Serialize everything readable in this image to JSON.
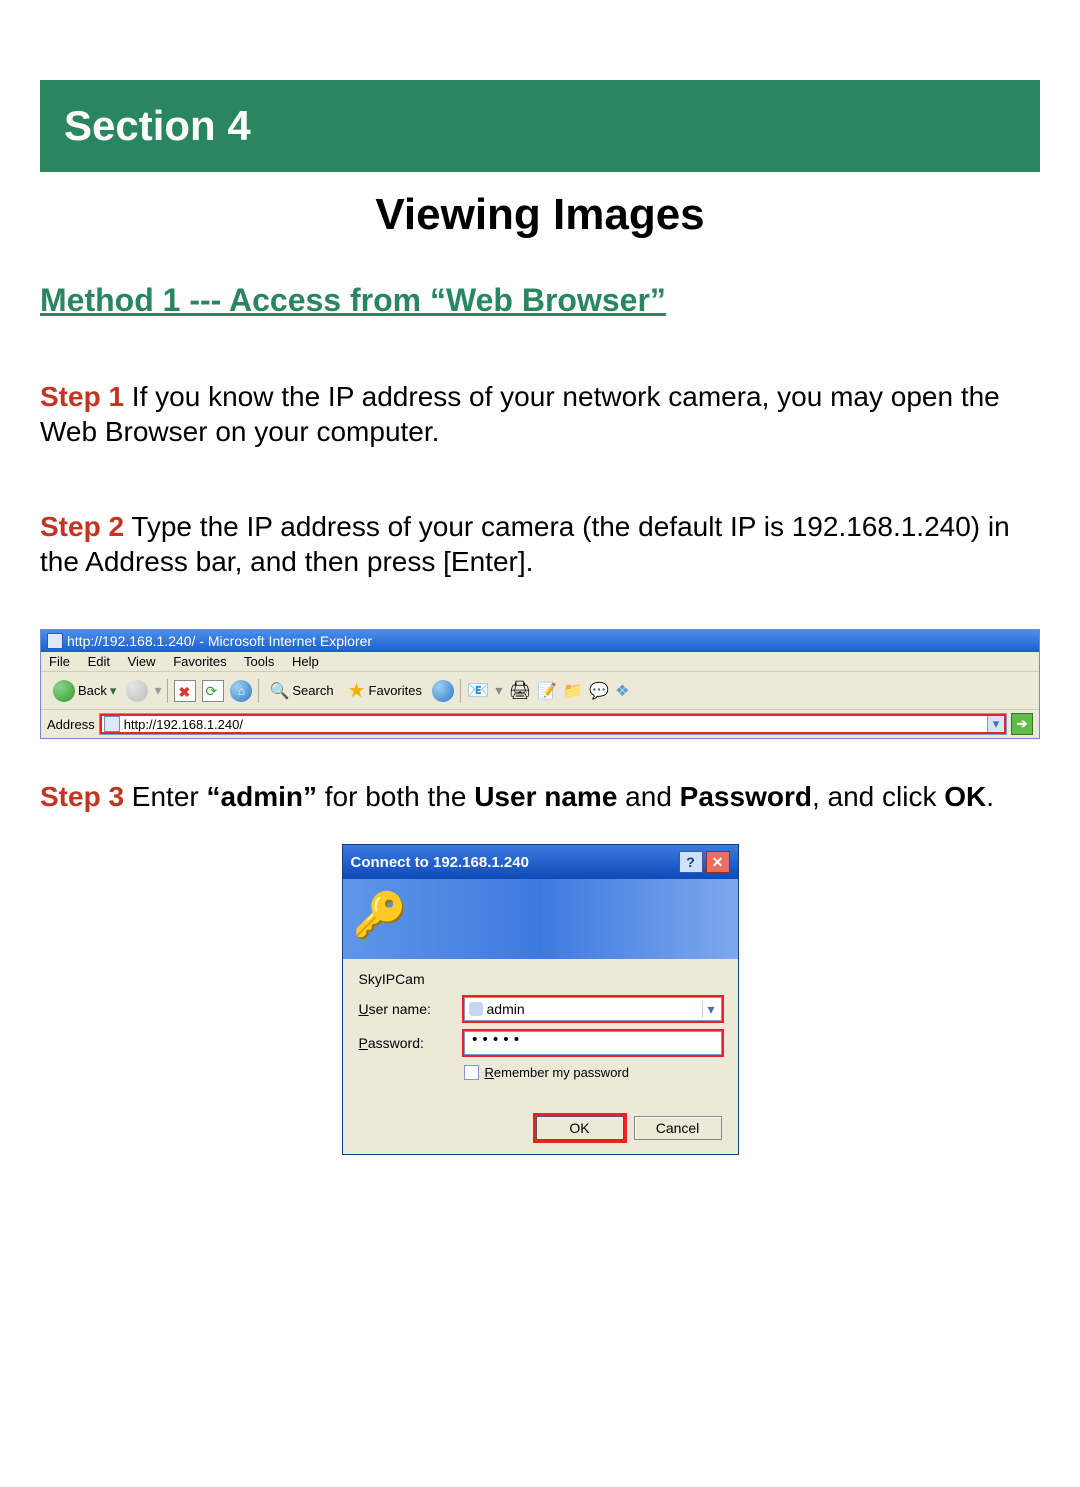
{
  "section_banner": "Section 4",
  "page_title": "Viewing Images",
  "method_heading": "Method 1 --- Access from “Web Browser”",
  "steps": {
    "s1": {
      "label": "Step 1",
      "text": " If you know the IP address of your network camera, you may open the Web Browser on your computer."
    },
    "s2": {
      "label": "Step 2",
      "text": " Type the IP address of your camera (the default IP is 192.168.1.240) in the Address bar, and then press [Enter]."
    },
    "s3": {
      "label": "Step 3",
      "pre": " Enter ",
      "admin_q": "“admin”",
      "mid1": " for both the ",
      "un": "User name",
      "mid2": " and ",
      "pw": "Password",
      "mid3": ", and click ",
      "ok": "OK",
      "end": "."
    }
  },
  "ie": {
    "title": "http://192.168.1.240/ - Microsoft Internet Explorer",
    "menu": {
      "file": "File",
      "edit": "Edit",
      "view": "View",
      "favorites": "Favorites",
      "tools": "Tools",
      "help": "Help"
    },
    "toolbar": {
      "back": "Back",
      "search": "Search",
      "favorites": "Favorites"
    },
    "address_label": "Address",
    "address_value": "http://192.168.1.240/",
    "go": "➔"
  },
  "login": {
    "title": "Connect to 192.168.1.240",
    "realm": "SkyIPCam",
    "username_label_pre": "U",
    "username_label": "ser name:",
    "password_label_pre": "P",
    "password_label": "assword:",
    "username_value": "admin",
    "password_masked": "•••••",
    "remember_pre": "R",
    "remember": "emember my password",
    "ok": "OK",
    "cancel": "Cancel",
    "help": "?",
    "close": "✕"
  }
}
